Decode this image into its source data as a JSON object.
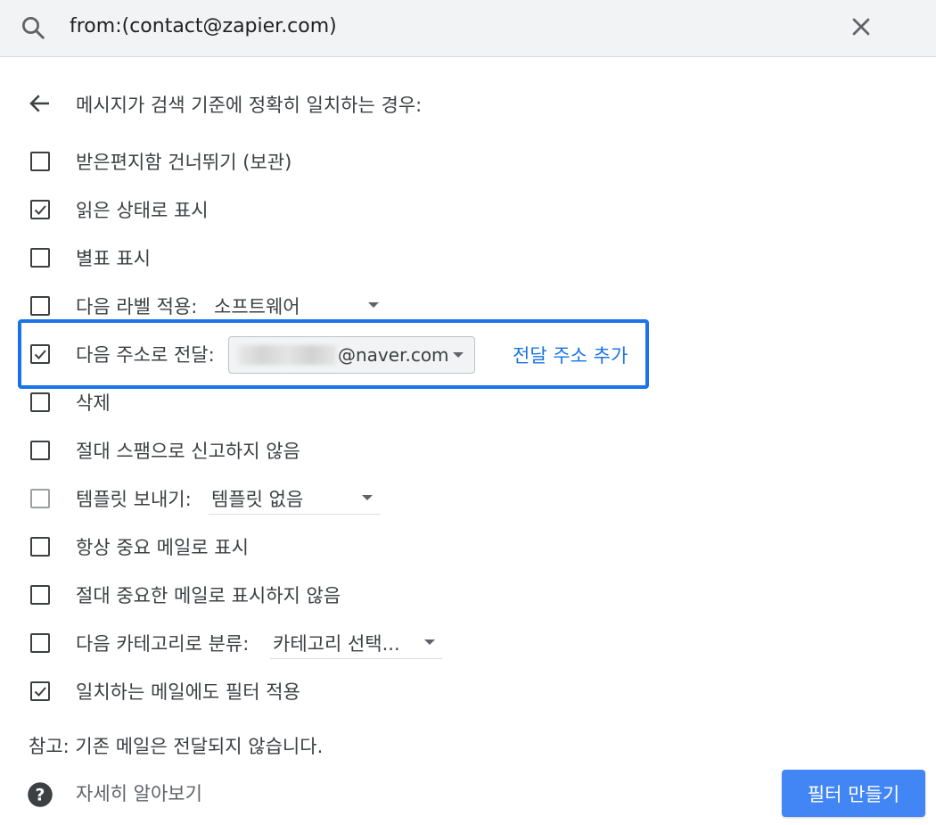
{
  "search": {
    "query": "from:(contact@zapier.com)",
    "search_icon": "search-icon",
    "close_icon": "close-icon"
  },
  "heading": "메시지가 검색 기준에 정확히 일치하는 경우:",
  "options": [
    {
      "label": "받은편지함 건너뛰기 (보관)",
      "checked": false
    },
    {
      "label": "읽은 상태로 표시",
      "checked": true
    },
    {
      "label": "별표 표시",
      "checked": false
    },
    {
      "label": "다음 라벨 적용:",
      "checked": false,
      "select_value": "소프트웨어"
    },
    {
      "label": "다음 주소로 전달:",
      "checked": true,
      "select_value": "@naver.com",
      "link": "전달 주소 추가"
    },
    {
      "label": "삭제",
      "checked": false
    },
    {
      "label": "절대 스팸으로 신고하지 않음",
      "checked": false
    },
    {
      "label": "템플릿 보내기:",
      "checked": false,
      "disabled": true,
      "select_value": "템플릿 없음"
    },
    {
      "label": "항상 중요 메일로 표시",
      "checked": false
    },
    {
      "label": "절대 중요한 메일로 표시하지 않음",
      "checked": false
    },
    {
      "label": "다음 카테고리로 분류:",
      "checked": false,
      "select_value": "카테고리 선택..."
    },
    {
      "label": "일치하는 메일에도 필터 적용",
      "checked": true
    }
  ],
  "note": "참고: 기존 메일은 전달되지 않습니다.",
  "learn_more": "자세히 알아보기",
  "create_button": "필터 만들기",
  "colors": {
    "accent": "#1a73e8",
    "button": "#4285f4",
    "topbar": "#f1f3f4"
  }
}
